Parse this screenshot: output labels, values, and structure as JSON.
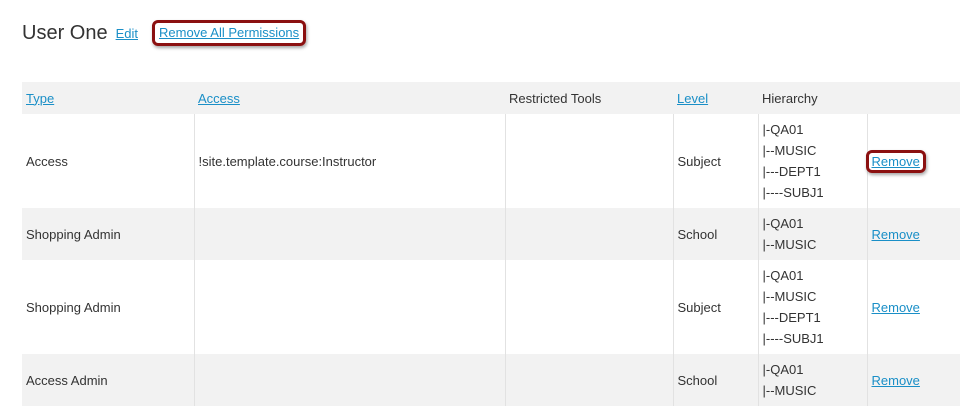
{
  "header": {
    "user_name": "User One",
    "edit_label": "Edit",
    "remove_all_label": "Remove All Permissions"
  },
  "table": {
    "columns": {
      "type": "Type",
      "access": "Access",
      "restricted_tools": "Restricted Tools",
      "level": "Level",
      "hierarchy": "Hierarchy"
    },
    "rows": [
      {
        "type": "Access",
        "access": "!site.template.course:Instructor",
        "restricted_tools": "",
        "level": "Subject",
        "hierarchy": [
          "|-QA01",
          "|--MUSIC",
          "|---DEPT1",
          "|----SUBJ1"
        ],
        "action": "Remove"
      },
      {
        "type": "Shopping Admin",
        "access": "",
        "restricted_tools": "",
        "level": "School",
        "hierarchy": [
          "|-QA01",
          "|--MUSIC"
        ],
        "action": "Remove"
      },
      {
        "type": "Shopping Admin",
        "access": "",
        "restricted_tools": "",
        "level": "Subject",
        "hierarchy": [
          "|-QA01",
          "|--MUSIC",
          "|---DEPT1",
          "|----SUBJ1"
        ],
        "action": "Remove"
      },
      {
        "type": "Access Admin",
        "access": "",
        "restricted_tools": "",
        "level": "School",
        "hierarchy": [
          "|-QA01",
          "|--MUSIC"
        ],
        "action": "Remove"
      }
    ]
  },
  "colors": {
    "link": "#1a8fc7",
    "highlight_border": "#8b1010",
    "row_alt": "#f2f2f2"
  }
}
